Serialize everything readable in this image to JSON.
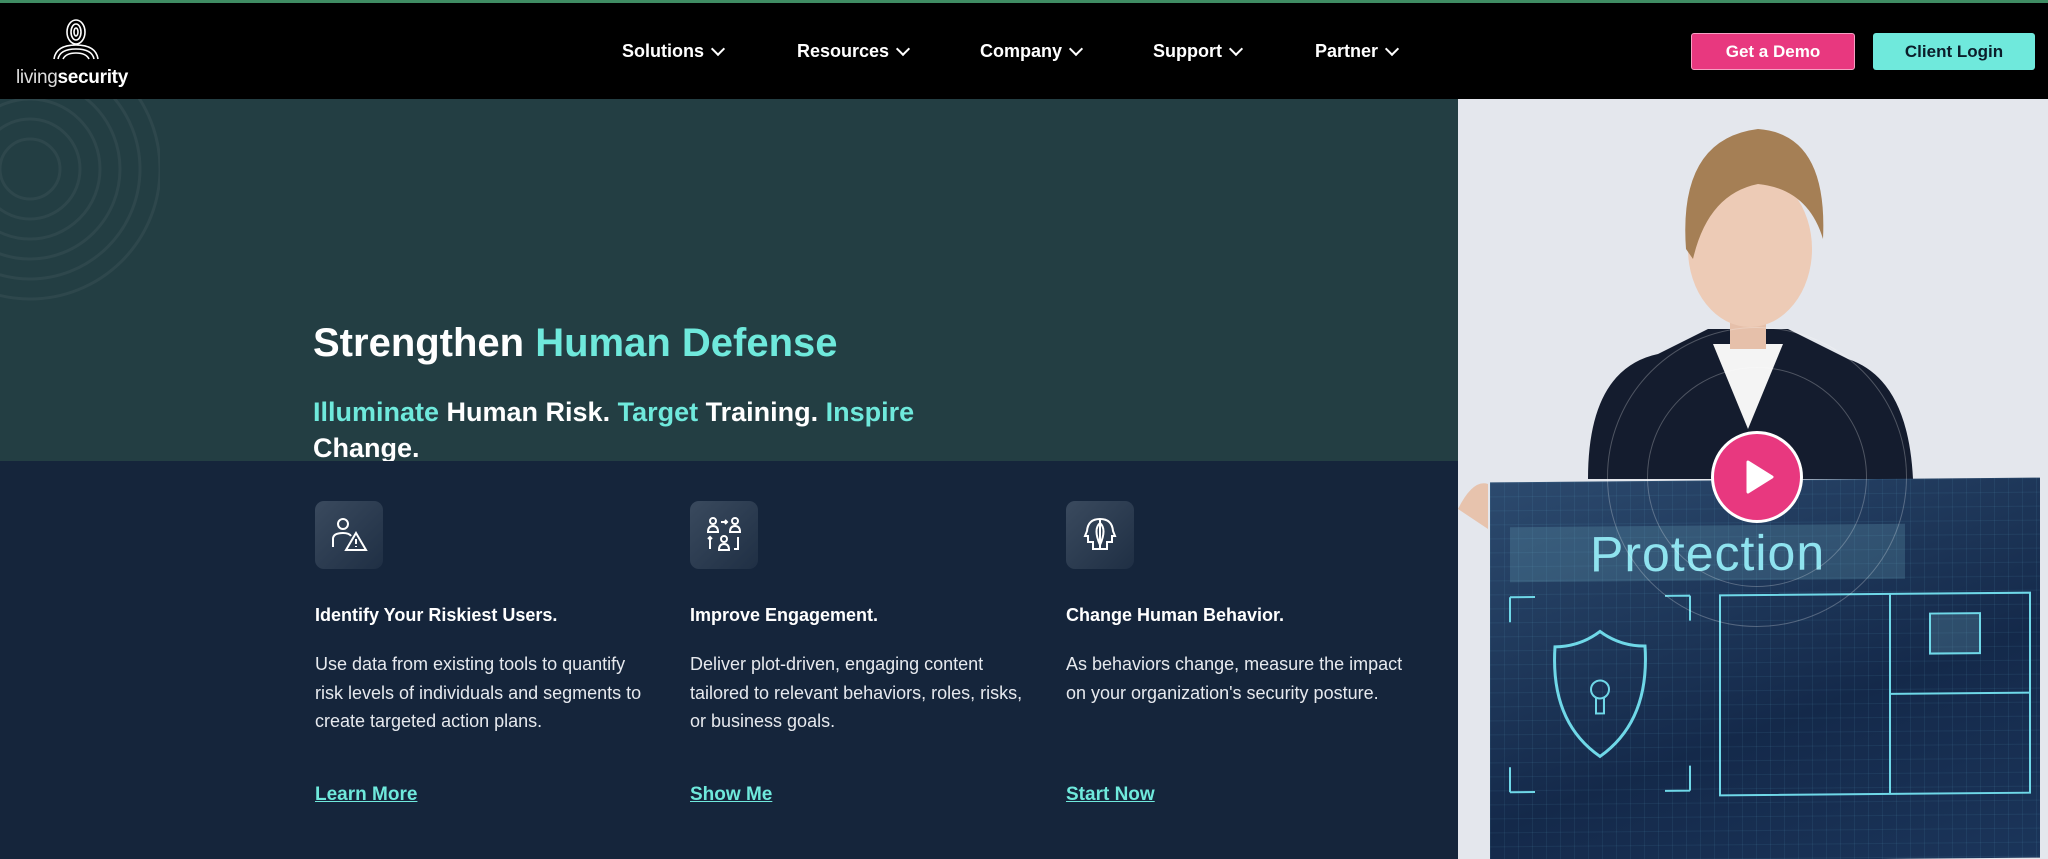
{
  "brand": {
    "logo_light": "living",
    "logo_bold": "security"
  },
  "nav": {
    "items": [
      {
        "label": "Solutions"
      },
      {
        "label": "Resources"
      },
      {
        "label": "Company"
      },
      {
        "label": "Support"
      },
      {
        "label": "Partner"
      }
    ],
    "demo_label": "Get a Demo",
    "login_label": "Client Login"
  },
  "hero": {
    "title_white": "Strengthen ",
    "title_teal": "Human Defense",
    "sub": [
      {
        "t": "Illuminate",
        "teal": true
      },
      {
        "t": " Human Risk. ",
        "teal": false
      },
      {
        "t": "Target",
        "teal": true
      },
      {
        "t": " Training. ",
        "teal": false
      },
      {
        "t": "Inspire",
        "teal": true
      },
      {
        "t": " Change.",
        "teal": false
      }
    ],
    "video_text": "Protection"
  },
  "features": [
    {
      "title": "Identify Your Riskiest Users.",
      "body": "Use data from existing tools to quantify risk levels of  individuals and segments to create targeted action plans.",
      "link": "Learn More",
      "icon": "user-warning-icon"
    },
    {
      "title": "Improve Engagement.",
      "body": "Deliver plot-driven, engaging content tailored to relevant behaviors, roles, risks, or business goals.",
      "link": "Show Me",
      "icon": "users-cycle-icon"
    },
    {
      "title": "Change Human Behavior.",
      "body": "As behaviors change, measure the impact on your organization's security posture.",
      "link": "Start Now",
      "icon": "heads-icon"
    }
  ],
  "colors": {
    "accent": "#6fe9dc",
    "pink": "#e8387f",
    "teal_bg": "#233e43",
    "navy_bg": "#15253b"
  }
}
